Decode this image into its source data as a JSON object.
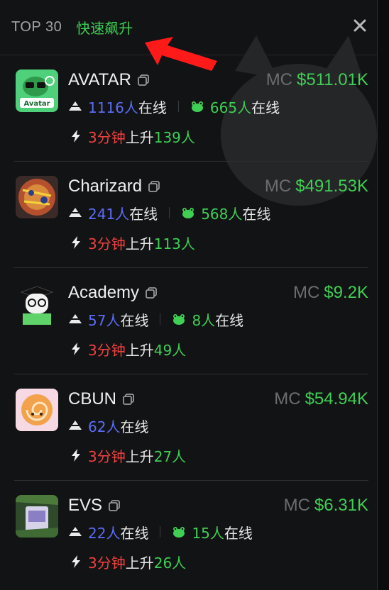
{
  "header": {
    "tab_top": "TOP 30",
    "tab_fast": "快速飙升"
  },
  "colors": {
    "accent_green": "#3fcf55",
    "online_blue": "#5b6cf5",
    "rise_red": "#f0413f",
    "arrow_red": "#ff1a1a"
  },
  "labels": {
    "mc": "MC",
    "online_suffix": "在线",
    "rise_label": "上升"
  },
  "tokens": [
    {
      "name": "AVATAR",
      "mc": "$511.01K",
      "holders": "1116人",
      "frogs": "665人",
      "rise_time": "3分钟",
      "rise_count": "139人",
      "has_frog": true
    },
    {
      "name": "Charizard",
      "mc": "$491.53K",
      "holders": "241人",
      "frogs": "568人",
      "rise_time": "3分钟",
      "rise_count": "113人",
      "has_frog": true
    },
    {
      "name": "Academy",
      "mc": "$9.2K",
      "holders": "57人",
      "frogs": "8人",
      "rise_time": "3分钟",
      "rise_count": "49人",
      "has_frog": true
    },
    {
      "name": "CBUN",
      "mc": "$54.94K",
      "holders": "62人",
      "frogs": "",
      "rise_time": "3分钟",
      "rise_count": "27人",
      "has_frog": false
    },
    {
      "name": "EVS",
      "mc": "$6.31K",
      "holders": "22人",
      "frogs": "15人",
      "rise_time": "3分钟",
      "rise_count": "26人",
      "has_frog": true
    }
  ]
}
